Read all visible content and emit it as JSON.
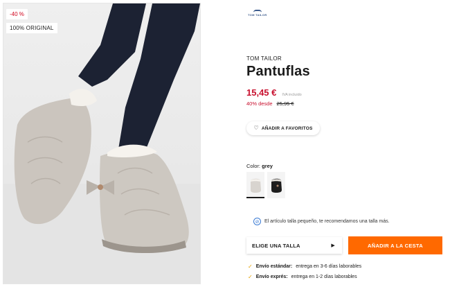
{
  "photo": {
    "discount_badge": "-40 %",
    "original_badge": "100% ORIGINAL"
  },
  "brand": {
    "logo_text": "TOM TAILOR",
    "name": "TOM TAILOR"
  },
  "product": {
    "title": "Pantuflas",
    "price": "15,45 €",
    "vat_note": "IVA incluido",
    "discount_text": "40% desde",
    "old_price": "25,95 €"
  },
  "favorites": {
    "label": "AÑADIR A FAVORITOS",
    "icon": "heart-icon"
  },
  "color": {
    "label": "Color:",
    "selected": "grey",
    "swatches": [
      {
        "name": "grey",
        "hex": "#d8d4cf"
      },
      {
        "name": "black",
        "hex": "#1e1e1e"
      }
    ]
  },
  "size_note": {
    "icon": "info-icon",
    "text": "El artículo talla pequeño, te recomendamos una talla más."
  },
  "size_select": {
    "label": "ELIGE UNA TALLA"
  },
  "cart": {
    "label": "AÑADIR A LA CESTA",
    "color": "#ff6900"
  },
  "delivery": [
    {
      "title": "Envío estándar:",
      "text": "entrega en 3-6 días laborables"
    },
    {
      "title": "Envío exprés:",
      "text": "entrega en 1-2 días laborables"
    }
  ],
  "colors": {
    "price_red": "#c8102e",
    "accent_orange": "#ff6900",
    "check_yellow": "#e5a100"
  }
}
